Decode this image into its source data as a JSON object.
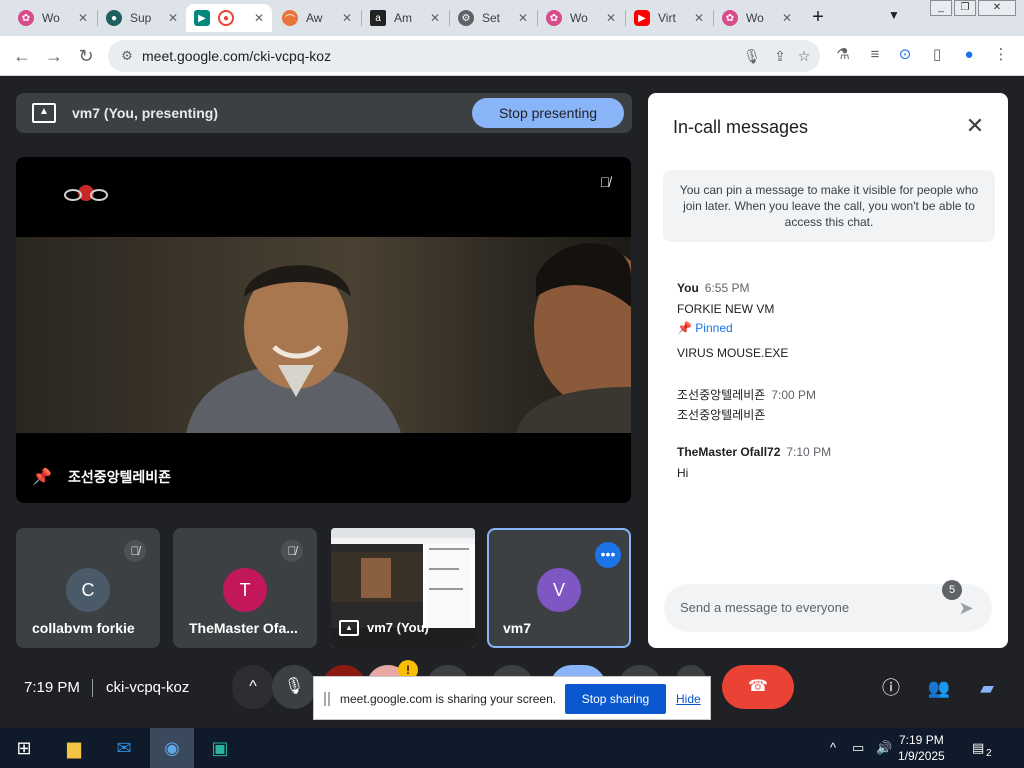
{
  "browser": {
    "tabs": [
      {
        "title": "Wo",
        "favicon": "flower-icon",
        "color": "#d94b8c"
      },
      {
        "title": "Sup",
        "favicon": "chat-icon",
        "color": "#1f5f5f"
      },
      {
        "title": "",
        "favicon": "meet-icon",
        "color": "#00897b",
        "active": true
      },
      {
        "title": "Aw",
        "favicon": "rainbow-icon",
        "color": "#e8743b"
      },
      {
        "title": "Am",
        "favicon": "amazon-icon",
        "color": "#222222"
      },
      {
        "title": "Set",
        "favicon": "gear-icon",
        "color": "#5f6368"
      },
      {
        "title": "Wo",
        "favicon": "flower-icon",
        "color": "#d94b8c"
      },
      {
        "title": "Virt",
        "favicon": "youtube-icon",
        "color": "#ff0000"
      },
      {
        "title": "Wo",
        "favicon": "flower-icon",
        "color": "#d94b8c"
      }
    ],
    "url": "meet.google.com/cki-vcpq-koz"
  },
  "presenting": {
    "label": "vm7 (You, presenting)",
    "stop_label": "Stop presenting"
  },
  "main_video": {
    "name_label": "조선중앙텔레비죤"
  },
  "tiles": [
    {
      "name": "collabvm forkie",
      "initial": "C",
      "color": "#4a5a68"
    },
    {
      "name": "TheMaster Ofa...",
      "initial": "T",
      "color": "#c2185b"
    },
    {
      "name": "vm7 (You)"
    },
    {
      "name": "vm7",
      "initial": "V",
      "color": "#7e57c2"
    }
  ],
  "chat": {
    "title": "In-call messages",
    "info": "You can pin a message to make it visible for people who join later. When you leave the call, you won't be able to access this chat.",
    "messages": [
      {
        "sender": "You",
        "time": "6:55 PM",
        "lines": [
          "FORKIE NEW VM"
        ],
        "pinned_label": "Pinned",
        "after_pin": "VIRUS MOUSE.EXE"
      },
      {
        "sender": "조선중앙텔레비죤",
        "time": "7:00 PM",
        "lines": [
          "조선중앙텔레비죤"
        ]
      },
      {
        "sender": "TheMaster Ofall72",
        "time": "7:10 PM",
        "lines": [
          "Hi"
        ]
      }
    ],
    "placeholder": "Send a message to everyone"
  },
  "controls": {
    "time": "7:19 PM",
    "meeting_code": "cki-vcpq-koz",
    "participant_count": "5"
  },
  "share_notice": {
    "text": "meet.google.com is sharing your screen.",
    "stop_label": "Stop sharing",
    "hide_label": "Hide"
  },
  "taskbar": {
    "time": "7:19 PM",
    "date": "1/9/2025",
    "notification_count": "2"
  }
}
